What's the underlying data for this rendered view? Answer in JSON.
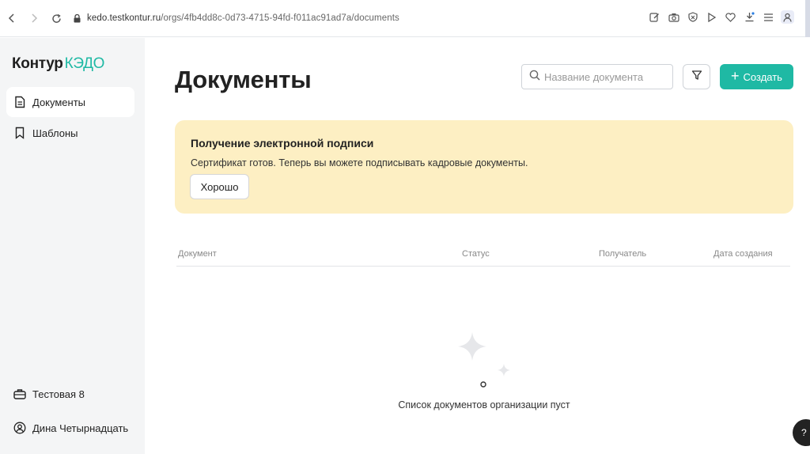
{
  "browser": {
    "url_host": "kedo.testkontur.ru",
    "url_path": "/orgs/4fb4dd8c-0d73-4715-94fd-f011ac91ad7a/documents"
  },
  "sidebar": {
    "logo_main": "Контур",
    "logo_accent": "КЭДО",
    "items": [
      {
        "label": "Документы",
        "icon": "document-icon",
        "active": true
      },
      {
        "label": "Шаблоны",
        "icon": "bookmark-icon",
        "active": false
      }
    ],
    "organization": {
      "label": "Тестовая 8",
      "icon": "briefcase-icon"
    },
    "user": {
      "label": "Дина Четырнадцать",
      "icon": "user-circle-icon"
    }
  },
  "main": {
    "title": "Документы",
    "search_placeholder": "Название документа",
    "create_label": "Создать",
    "banner": {
      "title": "Получение электронной подписи",
      "text": "Сертификат готов. Теперь вы можете подписывать кадровые документы.",
      "button_label": "Хорошо"
    },
    "table": {
      "columns": [
        "Документ",
        "Статус",
        "Получатель",
        "Дата создания"
      ]
    },
    "empty_text": "Список документов организации пуст"
  },
  "help": {
    "label": "?"
  },
  "colors": {
    "accent": "#1fb9a4",
    "banner_bg": "#fdefc3",
    "sidebar_bg": "#f4f5f6"
  }
}
